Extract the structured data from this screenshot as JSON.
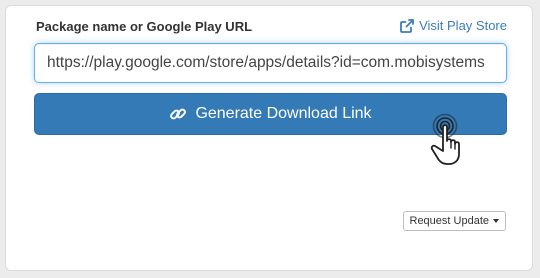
{
  "form": {
    "label": "Package name or Google Play URL",
    "visit_link_label": "Visit Play Store",
    "url_value": "https://play.google.com/store/apps/details?id=com.mobisystems",
    "generate_button_label": "Generate Download Link",
    "request_update_label": "Request Update"
  },
  "icons": {
    "visit_link": "external-link-icon",
    "generate_button": "link-icon",
    "cursor": "hand-pointer-icon",
    "request_update": "caret-down-icon"
  },
  "colors": {
    "accent": "#3a7dc0",
    "button_bg": "#337ab7",
    "input_focus_border": "#66afe9"
  }
}
